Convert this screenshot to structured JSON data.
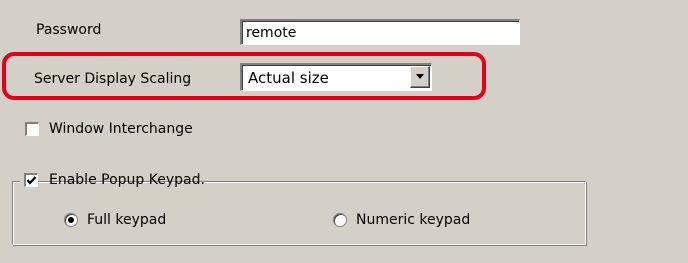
{
  "password": {
    "label": "Password",
    "value": "remote"
  },
  "server_display_scaling": {
    "label": "Server Display Scaling",
    "selected": "Actual size"
  },
  "window_interchange": {
    "label": "Window Interchange",
    "checked": false
  },
  "enable_popup_keypad": {
    "label": "Enable Popup Keypad.",
    "checked": true
  },
  "keypad_options": [
    {
      "label": "Full keypad",
      "selected": true
    },
    {
      "label": "Numeric keypad",
      "selected": false
    }
  ],
  "colors": {
    "highlight": "#e2001a",
    "background": "#d4d0c8"
  }
}
